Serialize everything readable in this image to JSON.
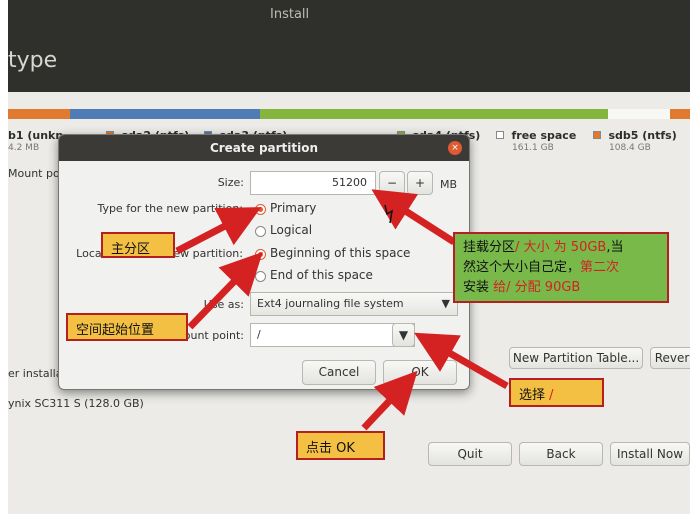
{
  "window": {
    "title": "Install",
    "page_title": "type"
  },
  "partition_bar": [
    {
      "name": "b1 (unkn",
      "size": "4.2 MB",
      "color": "#e07a2e"
    },
    {
      "name": "sda2 (ntfs)",
      "size": "",
      "color": "#e07a2e"
    },
    {
      "name": "sda3 (ntfs)",
      "size": "",
      "color": "#4f7cb6"
    },
    {
      "name": "sda4 (ntfs)",
      "size": "",
      "color": "#84b53c"
    },
    {
      "name": "free space",
      "size": "161.1 GB",
      "color": "#ffffff"
    },
    {
      "name": "sdb5 (ntfs)",
      "size": "108.4 GB",
      "color": "#e07a2e"
    }
  ],
  "background": {
    "mount_point": "Mount po",
    "installer_text": "er installa",
    "disk_text": "ynix SC311 S (128.0 GB)",
    "new_partition_table": "New Partition Table...",
    "revert": "Rever",
    "quit": "Quit",
    "back": "Back",
    "install_now": "Install Now"
  },
  "dialog": {
    "title": "Create partition",
    "size_label": "Size:",
    "size_value": "51200",
    "size_unit": "MB",
    "minus": "−",
    "plus": "+",
    "type_label": "Type for the new partition:",
    "type_primary": "Primary",
    "type_logical": "Logical",
    "location_label": "Location for the new partition:",
    "location_begin": "Beginning of this space",
    "location_end": "End of this space",
    "use_as_label": "Use as:",
    "use_as_value": "Ext4 journaling file system",
    "mount_label": "Mount point:",
    "mount_value": "/",
    "cancel": "Cancel",
    "ok": "OK"
  },
  "annotations": {
    "primary": "主分区",
    "space_start": "空间起始位置",
    "mount_desc_1": "挂载分区",
    "mount_desc_2": "/ 大小 为 50GB",
    "mount_desc_3": ",当",
    "mount_desc_4": "然这个大小自己定，",
    "mount_desc_5": "第二次",
    "mount_desc_6": "安装",
    "mount_desc_7": "给/ 分配 90GB",
    "select": "选择",
    "select_value": "/",
    "click_ok": "点击 OK"
  },
  "colors": {
    "accent": "#df5a30",
    "annotation_red": "#d42222",
    "annotation_green": "#78b94a",
    "annotation_yellow": "#f4c044"
  }
}
